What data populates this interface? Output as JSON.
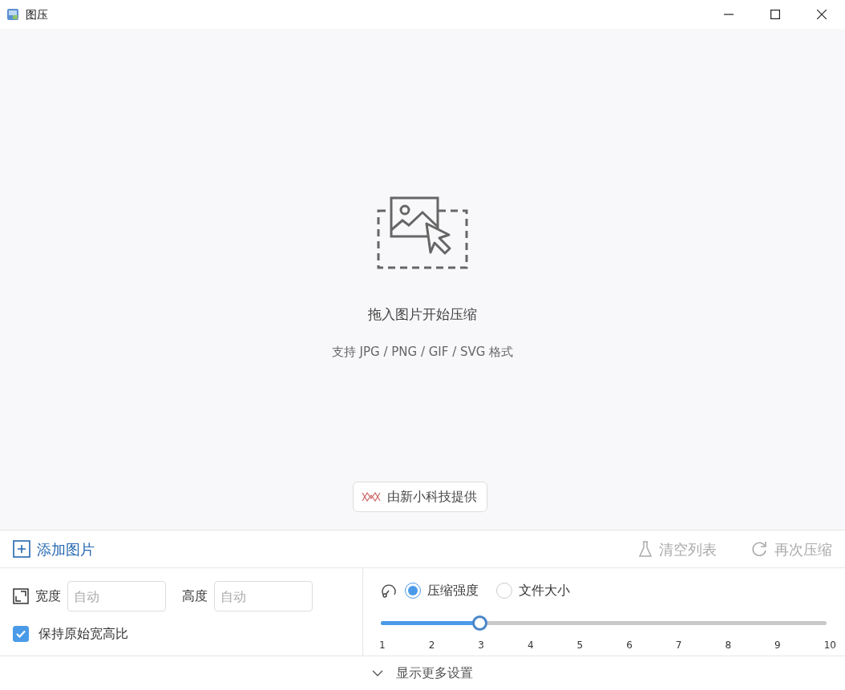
{
  "window": {
    "title": "图压"
  },
  "drop_area": {
    "title": "拖入图片开始压缩",
    "subtitle": "支持 JPG / PNG / GIF / SVG 格式",
    "credit": "由新小科技提供"
  },
  "toolbar": {
    "add": {
      "label": "添加图片"
    },
    "actions": [
      {
        "kind": "clear",
        "label": "清空列表",
        "disabled": true
      },
      {
        "kind": "recompress",
        "label": "再次压缩",
        "disabled": true
      }
    ]
  },
  "size": {
    "width_label": "宽度",
    "width_placeholder": "自动",
    "height_label": "高度",
    "height_placeholder": "自动",
    "keep_ratio": {
      "label": "保持原始宽高比",
      "checked": true
    }
  },
  "mode": {
    "options": [
      {
        "label": "压缩强度",
        "selected": true
      },
      {
        "label": "文件大小",
        "selected": false
      }
    ],
    "slider": {
      "level": 0.222,
      "ticks": [
        "1",
        "2",
        "3",
        "4",
        "5",
        "6",
        "7",
        "8",
        "9",
        "10"
      ]
    }
  },
  "more": {
    "label": "显示更多设置"
  }
}
